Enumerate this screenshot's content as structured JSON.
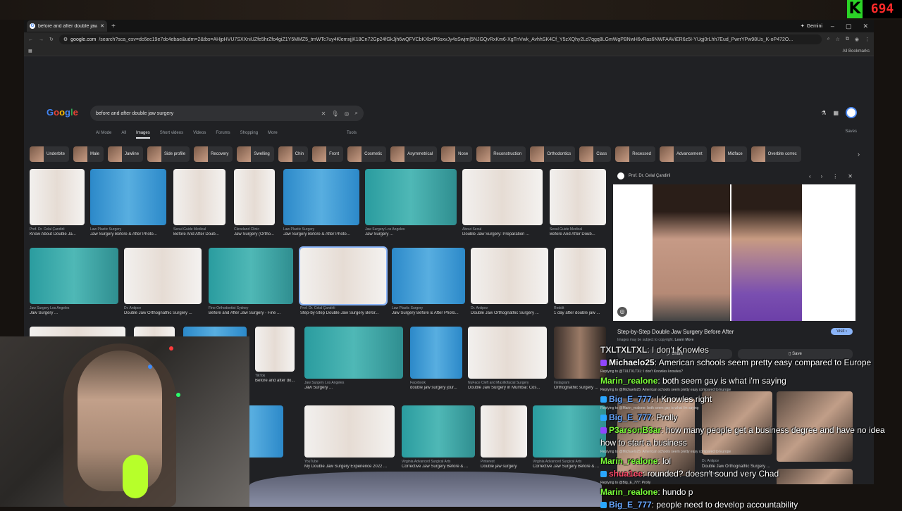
{
  "viewer_count": {
    "k_label": "K",
    "count": "694"
  },
  "browser": {
    "tab_title": "before and after double jaw sur",
    "gemini_label": "Gemini",
    "url_host": "google.com",
    "url_rest": "/search?sca_esv=dc6ec19e7dc4ebae&udm=2&tbs=AHjpHVU7SXXniUZfe5hrZfo4giZ1Y5MMZ5_tmWTc7uy4KlemxjjK18Cn72Gp24fGkJjh6wQFVCbKXb4P6sxvJy4sSwjm|5NJGQvRxKm6-XgTnVwk_AvhhSK4Cf_Y5zXQhy2Ld7qgq8LGmWgPBNwH6vRas6NWFAAViER6z5I-YUgj0rLhh7Eud_PwrrYPw98Us_K-oP472O...",
    "all_bookmarks": "All Bookmarks"
  },
  "search": {
    "query": "before and after double jaw surgery",
    "filters": [
      "AI Mode",
      "All",
      "Images",
      "Short videos",
      "Videos",
      "Forums",
      "Shopping",
      "More"
    ],
    "tools": "Tools",
    "saves": "Saves"
  },
  "chips": [
    "Underbite",
    "Male",
    "Jawline",
    "Side profile",
    "Recovery",
    "Swelling",
    "Chin",
    "Front",
    "Cosmetic",
    "Asymmetrical",
    "Nose",
    "Reconstruction",
    "Orthodontics",
    "Class",
    "Recessed",
    "Advancement",
    "Midface",
    "Overbite correc"
  ],
  "results": [
    {
      "src": "Prof. Dr. Celal Çandirli",
      "cap": "Know About Double Ja...",
      "color": "white"
    },
    {
      "src": "Law Plastic Surgery",
      "cap": "Jaw Surgery Before & After Photo...",
      "color": "blue"
    },
    {
      "src": "Seoul Guide Medical",
      "cap": "Before And After Doub...",
      "color": "white"
    },
    {
      "src": "Cleveland Clinic",
      "cap": "Jaw Surgery (Ortho...",
      "color": "white"
    },
    {
      "src": "Law Plastic Surgery",
      "cap": "Jaw Surgery Before & After Photo...",
      "color": "blue"
    },
    {
      "src": "Jaw Surgery Los Angeles",
      "cap": "Jaw Surgery ...",
      "color": "teal"
    },
    {
      "src": "About Seoul",
      "cap": "Double Jaw Surgery: Preparation ...",
      "color": "white"
    },
    {
      "src": "Seoul Guide Medical",
      "cap": "Before And After Doub...",
      "color": "white"
    },
    {
      "src": "Jaw Surgery Los Angeles",
      "cap": "Jaw Surgery ...",
      "color": "teal"
    },
    {
      "src": "Dr. Antipov",
      "cap": "Double Jaw Orthognathic Surgery ...",
      "color": "white"
    },
    {
      "src": "Fine Orthodontist Sydney",
      "cap": "Before and After Jaw Surgery - Fine ...",
      "color": "teal"
    },
    {
      "src": "Prof. Dr. Celal Çandirli",
      "cap": "Step-by-Step Double Jaw Surgery Befor...",
      "color": "white"
    },
    {
      "src": "Law Plastic Surgery",
      "cap": "Jaw Surgery Before & After Photo...",
      "color": "blue"
    },
    {
      "src": "Dr. Antipov",
      "cap": "Double Jaw Orthognathic Surgery ...",
      "color": "white"
    },
    {
      "src": "Reddit",
      "cap": "1 day after double jaw ...",
      "color": "white"
    },
    {
      "src": "",
      "cap": "",
      "color": "white"
    },
    {
      "src": "",
      "cap": "",
      "color": "white"
    },
    {
      "src": "",
      "cap": "",
      "color": "blue"
    },
    {
      "src": "TikTok",
      "cap": "Before and after do...",
      "color": "white"
    },
    {
      "src": "Jaw Surgery Los Angeles",
      "cap": "Jaw Surgery ...",
      "color": "teal"
    },
    {
      "src": "Facebook",
      "cap": "double jaw surgery jour...",
      "color": "blue"
    },
    {
      "src": "NuFace Cleft and Maxillofacial Surgery",
      "cap": "Double Jaw Surgery in Mumbai: Cos...",
      "color": "white"
    },
    {
      "src": "Instagram",
      "cap": "Orthognathic surgery ...",
      "color": "dark"
    },
    {
      "src": "Surgery",
      "cap": "",
      "color": "blue"
    },
    {
      "src": "YouTube",
      "cap": "My Double Jaw Surgery Experience 2022 ...",
      "color": "white"
    },
    {
      "src": "Virginia Advanced Surgical Arts",
      "cap": "Corrective Jaw Surgery Before & ...",
      "color": "teal"
    },
    {
      "src": "Pinterest",
      "cap": "Double jaw surgery",
      "color": "white"
    },
    {
      "src": "Virginia Advanced Surgical Arts",
      "cap": "Corrective Jaw Surgery Before & ...",
      "color": "teal"
    }
  ],
  "panel": {
    "source": "Prof. Dr. Celal Çandirli",
    "title": "Step-by-Step Double Jaw Surgery Before After",
    "visit": "Visit",
    "copyright": "Images may be subject to copyright.",
    "learn_more": "Learn More",
    "share": "Share",
    "save": "Save",
    "related": [
      {
        "src": "Dr. Antipov",
        "cap": "Double Jaw Orthognathic Surgery ..."
      },
      {
        "src": "Instagram",
        "cap": ""
      },
      {
        "src": "Law Plastic Surgery",
        "cap": ""
      }
    ]
  },
  "chat": [
    {
      "user": "TXLTXLTXL",
      "color": "#e0e0e0",
      "text": "I don't Knowles",
      "badge": ""
    },
    {
      "user": "Michaelo25",
      "color": "#ffffff",
      "text": "American schools seem pretty easy compared to Europe",
      "badge": "#9146ff"
    },
    {
      "reply": "Replying to @TXLTXLTXL: I don't Knowles knowles?"
    },
    {
      "user": "Marin_realone",
      "color": "#7cff3a",
      "text": "both seem gay is what i'm saying",
      "badge": ""
    },
    {
      "reply": "Replying to @Michaelo25: American schools seem pretty easy compared to Europe"
    },
    {
      "user": "Big_E_777",
      "color": "#6aa8ff",
      "text": "I Knowles right",
      "badge": "#2aa7ff"
    },
    {
      "reply": "Replying to @Marin_realone: both seem gay is what i'm saying"
    },
    {
      "user": "Big_E_777",
      "color": "#6aa8ff",
      "text": "Prolly",
      "badge": "#2aa7ff"
    },
    {
      "user": "P3arsonB3ar",
      "color": "#7cff3a",
      "text": "how many people get a business degree and have no idea how to start a business",
      "badge": "#9146ff"
    },
    {
      "reply": "Replying to @Michaelo25: American schools seem pretty easy compared to Europe"
    },
    {
      "user": "Marin_realone",
      "color": "#7cff3a",
      "text": "lol",
      "badge": ""
    },
    {
      "user": "shua1ee",
      "color": "#ff4a6a",
      "text": "rounded? doesn't sound very Chad",
      "badge": "#2aa7ff"
    },
    {
      "reply": "Replying to @Big_E_777: Prolly"
    },
    {
      "user": "Marin_realone",
      "color": "#7cff3a",
      "text": "hundo p",
      "badge": ""
    },
    {
      "user": "Big_E_777",
      "color": "#6aa8ff",
      "text": "people need to develop accountability",
      "badge": "#2aa7ff"
    }
  ]
}
